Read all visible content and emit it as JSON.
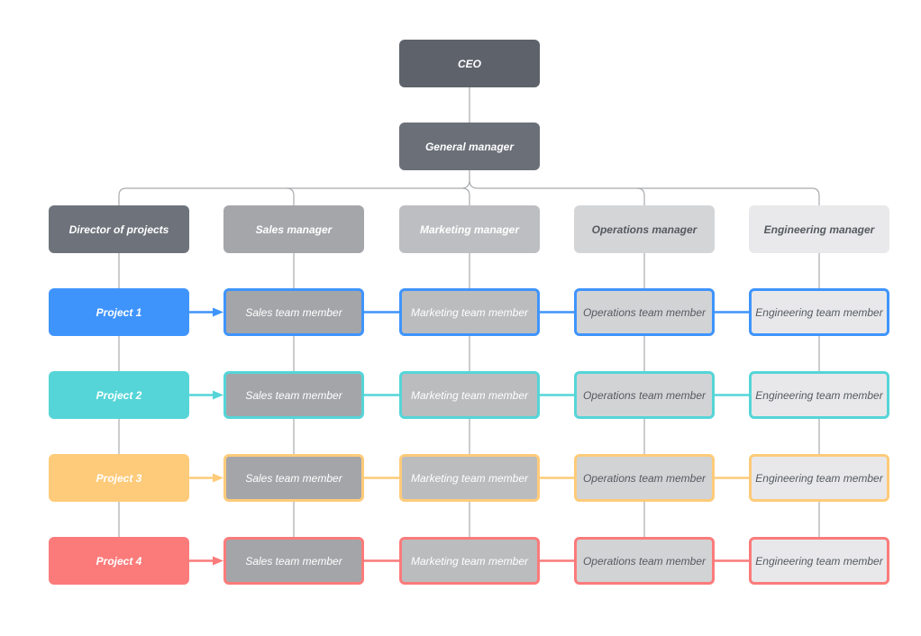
{
  "ceo": {
    "label": "CEO",
    "fill": "#5e636b"
  },
  "general_manager": {
    "label": "General manager",
    "fill": "#6b7078"
  },
  "columns": [
    {
      "manager": "Director of projects",
      "fill": "#6e737b",
      "member_fill": "",
      "text": "#ffffff"
    },
    {
      "manager": "Sales manager",
      "fill": "#a5a6aa",
      "member": "Sales team member",
      "member_fill": "#a4a5a9",
      "text": "#ffffff"
    },
    {
      "manager": "Marketing manager",
      "fill": "#bdbec1",
      "member": "Marketing team member",
      "member_fill": "#bbbcbe",
      "text": "#ffffff"
    },
    {
      "manager": "Operations manager",
      "fill": "#d4d5d7",
      "member": "Operations team member",
      "member_fill": "#d2d3d5",
      "text": "#555a60"
    },
    {
      "manager": "Engineering manager",
      "fill": "#e9e9eb",
      "member": "Engineering team member",
      "member_fill": "#e8e8ea",
      "text": "#555a60"
    }
  ],
  "projects": [
    {
      "label": "Project 1",
      "color": "#3f94fc"
    },
    {
      "label": "Project 2",
      "color": "#55d5d8"
    },
    {
      "label": "Project 3",
      "color": "#fecb7a"
    },
    {
      "label": "Project 4",
      "color": "#fb7b7b"
    }
  ],
  "line_color": "#a9abae"
}
